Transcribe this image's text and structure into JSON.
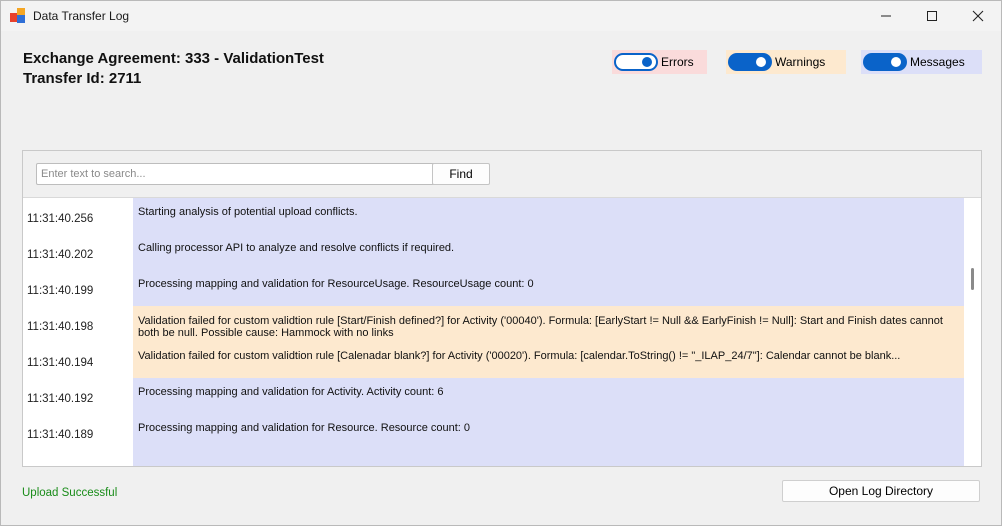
{
  "window": {
    "title": "Data Transfer Log"
  },
  "header": {
    "title": "Exchange Agreement: 333 - ValidationTest",
    "subtitle": "Transfer Id: 2711"
  },
  "filters": [
    {
      "label": "Errors",
      "enabled": false,
      "bg": "#fadbdb"
    },
    {
      "label": "Warnings",
      "enabled": true,
      "bg": "#fde9cf"
    },
    {
      "label": "Messages",
      "enabled": true,
      "bg": "#dcdff8"
    }
  ],
  "search": {
    "placeholder": "Enter text to search...",
    "button_label": "Find"
  },
  "log_rows": [
    {
      "time": "11:31:40.256",
      "message": "Starting analysis of potential upload conflicts.",
      "level": "message"
    },
    {
      "time": "11:31:40.202",
      "message": "Calling processor API to analyze and resolve conflicts if required.",
      "level": "message"
    },
    {
      "time": "11:31:40.199",
      "message": "Processing mapping and validation for ResourceUsage.  ResourceUsage count: 0",
      "level": "message"
    },
    {
      "time": "11:31:40.198",
      "message": "Validation failed for custom validtion rule [Start/Finish defined?] for Activity ('00040'). Formula: [EarlyStart != Null && EarlyFinish != Null]: Start and Finish dates cannot both be null. Possible cause: Hammock with no links",
      "level": "warning"
    },
    {
      "time": "11:31:40.194",
      "message": "Validation failed for custom validtion rule [Calenadar blank?] for Activity ('00020'). Formula: [calendar.ToString() != \"_ILAP_24/7\"]: Calendar cannot be blank...",
      "level": "warning"
    },
    {
      "time": "11:31:40.192",
      "message": "Processing mapping and validation for Activity.  Activity count: 6",
      "level": "message"
    },
    {
      "time": "11:31:40.189",
      "message": "Processing mapping and validation for Resource.  Resource count: 0",
      "level": "message"
    },
    {
      "time": "",
      "message": "",
      "level": "message"
    }
  ],
  "level_colors": {
    "message": "#dcdff8",
    "warning": "#fde9cf",
    "error": "#fadbdb"
  },
  "footer": {
    "status": "Upload Successful",
    "status_color": "#198c19",
    "open_log_label": "Open Log Directory"
  }
}
